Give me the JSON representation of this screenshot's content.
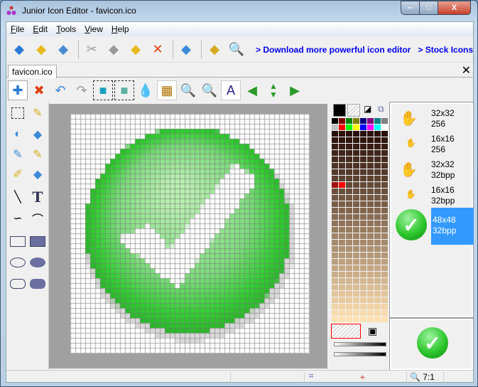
{
  "window": {
    "title": "Junior Icon Editor - favicon.ico",
    "min": "‒",
    "max": "□",
    "close": "X"
  },
  "menu": [
    {
      "u": "F",
      "rest": "ile"
    },
    {
      "u": "E",
      "rest": "dit"
    },
    {
      "u": "T",
      "rest": "ools"
    },
    {
      "u": "V",
      "rest": "iew"
    },
    {
      "u": "H",
      "rest": "elp"
    }
  ],
  "toolbar": {
    "links": [
      "> Download more powerful icon editor",
      "> Stock Icons"
    ]
  },
  "tab": {
    "label": "favicon.ico",
    "close": "✕"
  },
  "images": [
    {
      "size": "32x32",
      "depth": "256"
    },
    {
      "size": "16x16",
      "depth": "256"
    },
    {
      "size": "32x32",
      "depth": "32bpp"
    },
    {
      "size": "16x16",
      "depth": "32bpp"
    },
    {
      "size": "48x48",
      "depth": "32bpp"
    }
  ],
  "status": {
    "zoom": "7:1"
  },
  "colors": {
    "accent": "#3399ff",
    "check": "#2ec72e"
  },
  "tools_text": {
    "text_tool": "T"
  }
}
